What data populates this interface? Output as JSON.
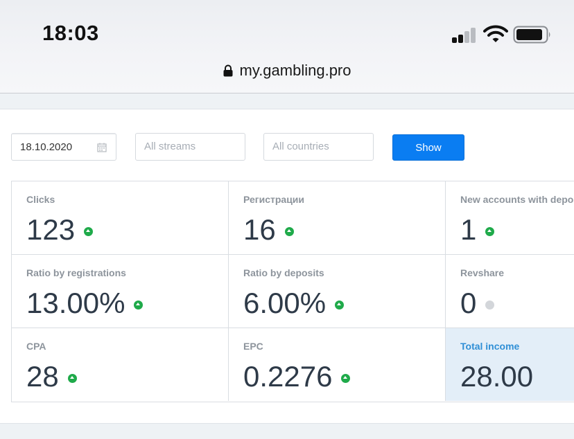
{
  "status_bar": {
    "time": "18:03"
  },
  "address_bar": {
    "url": "my.gambling.pro"
  },
  "filters": {
    "date_value": "18.10.2020",
    "streams_placeholder": "All streams",
    "countries_placeholder": "All countries",
    "show_label": "Show"
  },
  "stats": [
    {
      "label": "Clicks",
      "value": "123",
      "trend": "up"
    },
    {
      "label": "Регистрации",
      "value": "16",
      "trend": "up"
    },
    {
      "label": "New accounts with depo",
      "value": "1",
      "trend": "up"
    },
    {
      "label": "Ratio by registrations",
      "value": "13.00%",
      "trend": "up"
    },
    {
      "label": "Ratio by deposits",
      "value": "6.00%",
      "trend": "up"
    },
    {
      "label": "Revshare",
      "value": "0",
      "trend": "neutral"
    },
    {
      "label": "CPA",
      "value": "28",
      "trend": "up"
    },
    {
      "label": "EPC",
      "value": "0.2276",
      "trend": "up"
    },
    {
      "label": "Total income",
      "value": "28.00",
      "trend": "none"
    }
  ],
  "colors": {
    "accent": "#0a7df2",
    "trend_up": "#1faa4a",
    "trend_neutral": "#d3d6da",
    "highlight_bg": "#e3eef8",
    "highlight_label": "#2f8fd6"
  },
  "icons": {
    "signal": "cellular-signal-icon",
    "wifi": "wifi-icon",
    "battery": "battery-icon",
    "lock": "lock-icon",
    "calendar": "calendar-icon"
  }
}
